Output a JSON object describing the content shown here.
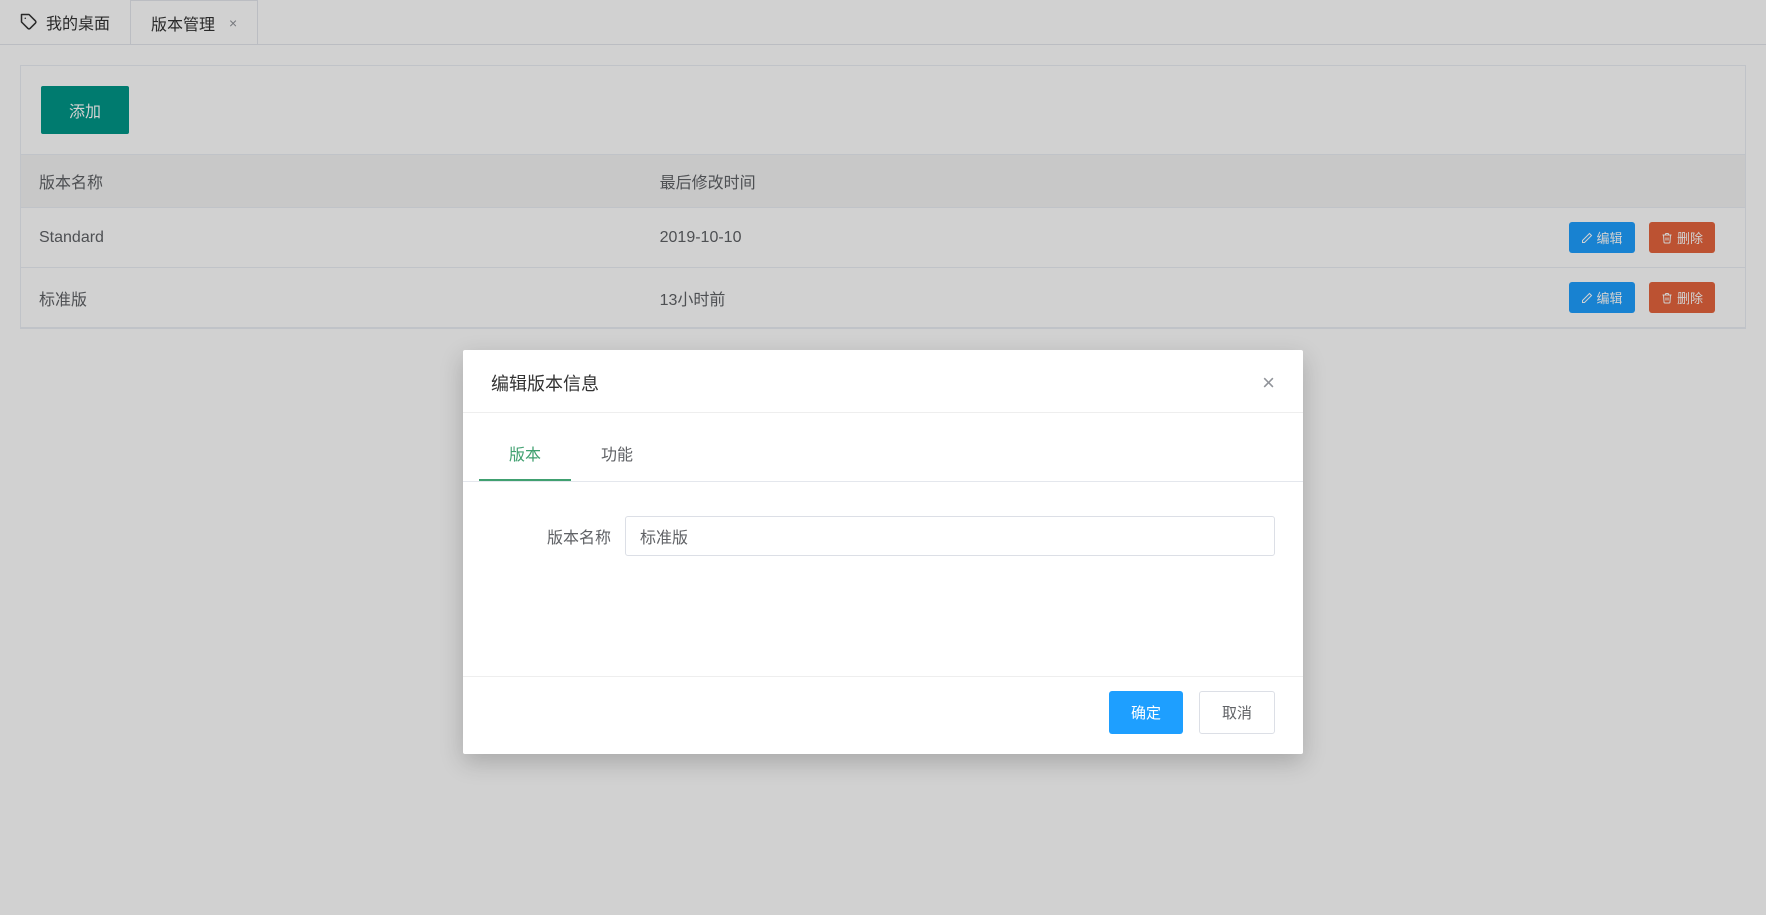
{
  "tabs": {
    "home": "我的桌面",
    "active": "版本管理"
  },
  "toolbar": {
    "add_label": "添加"
  },
  "table": {
    "headers": {
      "name": "版本名称",
      "modified": "最后修改时间",
      "actions": ""
    },
    "rows": [
      {
        "name": "Standard",
        "modified": "2019-10-10"
      },
      {
        "name": "标准版",
        "modified": "13小时前"
      }
    ],
    "edit_label": "编辑",
    "delete_label": "删除"
  },
  "dialog": {
    "title": "编辑版本信息",
    "tabs": {
      "version": "版本",
      "feature": "功能"
    },
    "form": {
      "name_label": "版本名称",
      "name_value": "标准版"
    },
    "confirm": "确定",
    "cancel": "取消"
  }
}
